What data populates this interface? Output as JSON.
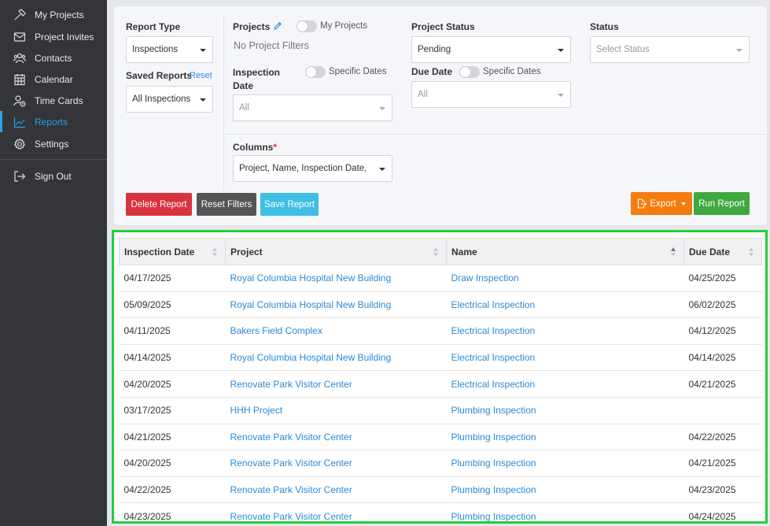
{
  "sidebar": {
    "items": [
      {
        "label": "My Projects",
        "icon": "hammer-icon"
      },
      {
        "label": "Project Invites",
        "icon": "envelope-icon"
      },
      {
        "label": "Contacts",
        "icon": "contacts-icon"
      },
      {
        "label": "Calendar",
        "icon": "calendar-icon"
      },
      {
        "label": "Time Cards",
        "icon": "time-card-icon"
      },
      {
        "label": "Reports",
        "icon": "chart-line-icon"
      },
      {
        "label": "Settings",
        "icon": "gear-icon"
      }
    ],
    "active_item": "Reports",
    "accent_color": "#2b9fe6",
    "sign_out": {
      "label": "Sign Out",
      "icon": "sign-out-icon"
    }
  },
  "filters": {
    "report_type": {
      "label": "Report Type",
      "value": "Inspections"
    },
    "saved_reports": {
      "label": "Saved Reports",
      "reset_label": "Reset",
      "value": "All Inspections"
    },
    "projects": {
      "label": "Projects",
      "edit_icon": "pencil-icon",
      "toggle_label": "My Projects",
      "toggle_on": false,
      "empty_text": "No Project Filters"
    },
    "inspection_date": {
      "label": "Inspection Date",
      "toggle_label": "Specific Dates",
      "toggle_on": false,
      "placeholder": "All"
    },
    "columns": {
      "label": "Columns",
      "required_mark": "*",
      "value": "Project, Name, Inspection Date,"
    },
    "project_status": {
      "label": "Project Status",
      "value": "Pending"
    },
    "due_date": {
      "label": "Due Date",
      "toggle_label": "Specific Dates",
      "toggle_on": false,
      "placeholder": "All"
    },
    "status": {
      "label": "Status",
      "placeholder": "Select Status"
    }
  },
  "actions": {
    "delete": {
      "label": "Delete Report",
      "color": "#d9333f"
    },
    "reset": {
      "label": "Reset Filters",
      "color": "#555555"
    },
    "save": {
      "label": "Save Report",
      "color": "#3fbfe4"
    },
    "export": {
      "label": "Export",
      "color": "#f57c0f"
    },
    "run": {
      "label": "Run Report",
      "color": "#3fa940"
    }
  },
  "table": {
    "columns": [
      {
        "label": "Inspection Date",
        "sort": "none"
      },
      {
        "label": "Project",
        "sort": "none"
      },
      {
        "label": "Name",
        "sort": "asc"
      },
      {
        "label": "Due Date",
        "sort": "none"
      }
    ],
    "rows": [
      {
        "inspection_date": "04/17/2025",
        "project": "Royal Columbia Hospital New Building",
        "name": "Draw Inspection",
        "due_date": "04/25/2025"
      },
      {
        "inspection_date": "05/09/2025",
        "project": "Royal Columbia Hospital New Building",
        "name": "Electrical Inspection",
        "due_date": "06/02/2025"
      },
      {
        "inspection_date": "04/11/2025",
        "project": "Bakers Field Complex",
        "name": "Electrical Inspection",
        "due_date": "04/12/2025"
      },
      {
        "inspection_date": "04/14/2025",
        "project": "Royal Columbia Hospital New Building",
        "name": "Electrical Inspection",
        "due_date": "04/14/2025"
      },
      {
        "inspection_date": "04/20/2025",
        "project": "Renovate Park Visitor Center",
        "name": "Electrical Inspection",
        "due_date": "04/21/2025"
      },
      {
        "inspection_date": "03/17/2025",
        "project": "HHH Project",
        "name": "Plumbing Inspection",
        "due_date": ""
      },
      {
        "inspection_date": "04/21/2025",
        "project": "Renovate Park Visitor Center",
        "name": "Plumbing Inspection",
        "due_date": "04/22/2025"
      },
      {
        "inspection_date": "04/20/2025",
        "project": "Renovate Park Visitor Center",
        "name": "Plumbing Inspection",
        "due_date": "04/21/2025"
      },
      {
        "inspection_date": "04/22/2025",
        "project": "Renovate Park Visitor Center",
        "name": "Plumbing Inspection",
        "due_date": "04/23/2025"
      },
      {
        "inspection_date": "04/23/2025",
        "project": "Renovate Park Visitor Center",
        "name": "Plumbing Inspection",
        "due_date": "04/24/2025"
      }
    ],
    "highlight_color": "#22d03a"
  }
}
